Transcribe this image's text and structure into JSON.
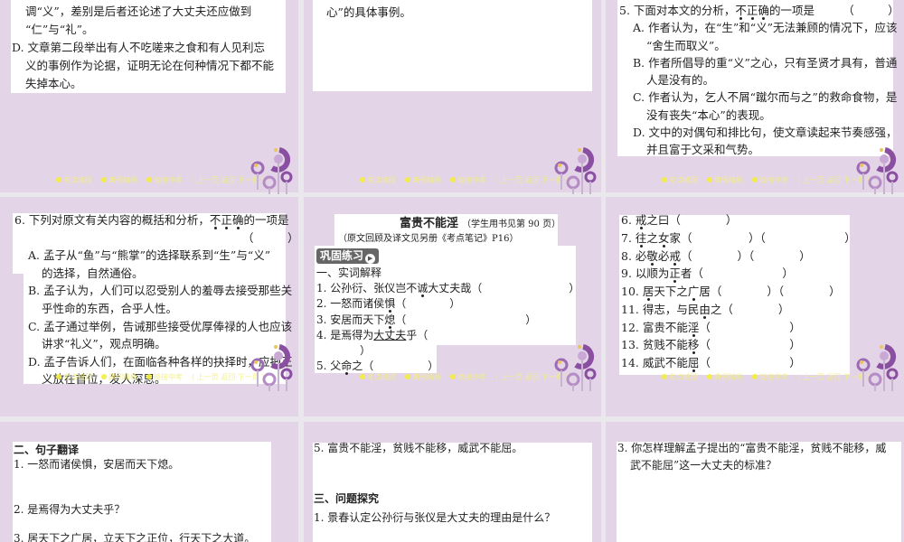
{
  "footer": {
    "items": [
      "考点梳理",
      "典例精析",
      "链接中考"
    ],
    "nav": "( 上一页  返回  下一页 )"
  },
  "colors": {
    "slide_bg": "#e3d4e7",
    "accent_purple": "#8a4fa0",
    "footer_yellow": "#f5ef3a"
  },
  "slide1": {
    "lines": [
      "调“义”，差别是后者还论述了大丈夫还应做到",
      "“仁”与“礼”。",
      "D. 文章第二段举出有人不吃嗟来之食和有人见利忘",
      "义的事例作为论据，证明无论在何种情况下都不能",
      "失掉本心。"
    ]
  },
  "slide2": {
    "lines": [
      "心”的具体事例。"
    ]
  },
  "slide3": {
    "lines": [
      "5. 下面对本文的分析，{不}{正}{确}的一项是　　　（　　　）",
      "A. 作者认为，在“生”和“义”无法兼顾的情况下，应该",
      "“舍生而取义”。",
      "B. 作者所倡导的重“义”之心，只有圣贤才具有，普通",
      "人是没有的。",
      "C. 作者认为，乞人不屑“蹴尔而与之”的救命食物，是",
      "没有丧失“本心”的表现。",
      "D. 文中的对偶句和排比句，使文章读起来节奏感强，",
      "并且富于文采和气势。"
    ]
  },
  "slide4": {
    "lines": [
      "6. 下列对原文有关内容的概括和分析，{不}{正}{确}的一项是",
      "（　　　）",
      "A. 孟子从“鱼”与“熊掌”的选择联系到“生”与“义”",
      "的选择，自然通俗。",
      "B. 孟子认为，人们可以忍受别人的羞辱去接受那些关",
      "乎性命的东西，合乎人性。",
      "C. 孟子通过举例，告诫那些接受优厚俸禄的人也应该",
      "讲求“礼义”，观点明确。",
      "D. 孟子告诉人们，在面临各种各样的抉择时，应把正",
      "义放在首位，发人深思。"
    ]
  },
  "slide5": {
    "title": "富贵不能淫",
    "title_note": "（学生用书见第 90 页）",
    "subtitle": "（原文回顾及译文见另册《考点笔记》P16）",
    "badge": "巩固练习",
    "lines": [
      "一、实词解释",
      "1. 公孙衍、张仪岂不{诚}大丈夫哉（　　　　　　　　）",
      "2. 一怒而诸侯{惧}（　　　　）",
      "3. 安居而天下{熄}（　　　　　　　　　　　）",
      "4. 是焉得为[大丈夫]乎（",
      "　　　　）",
      "5. 父{命}之（　　　　　）"
    ]
  },
  "slide6": {
    "lines": [
      "6. {戒}之曰（　　　　）",
      "7. {往}之{女}家（　　　　　）（　　　　　　　）",
      "8. 必{敬}必{戒}（　　　　）（　　　　）",
      "9. 以顺为{正}者（　　　　　　　）",
      "10. {居}天下之{广}居（　　　　）（　　　　）",
      "11. 得志，与民{由}之（　　　　）",
      "12. 富贵不能{淫}（　　　　　　　）",
      "13. 贫贱不能{移}（　　　　　　　）",
      "14. 威武不能{屈}（　　　　　　　）"
    ]
  },
  "slide7": {
    "heading": "二、句子翻译",
    "q1": "1. 一怒而诸侯惧，安居而天下熄。",
    "q2": "2. 是焉得为大丈夫乎？",
    "q3": "3. 居天下之广居，立天下之正位，行天下之大道。"
  },
  "slide8": {
    "q5": "5. 富贵不能淫，贫贱不能移，威武不能屈。",
    "heading": "三、问题探究",
    "q1": "1. 景春认定公孙衍与张仪是大丈夫的理由是什么？"
  },
  "slide9": {
    "q3_line1": "3. 你怎样理解孟子提出的“富贵不能淫，贫贱不能移，威",
    "q3_line2": "武不能屈”这一大丈夫的标准？"
  }
}
